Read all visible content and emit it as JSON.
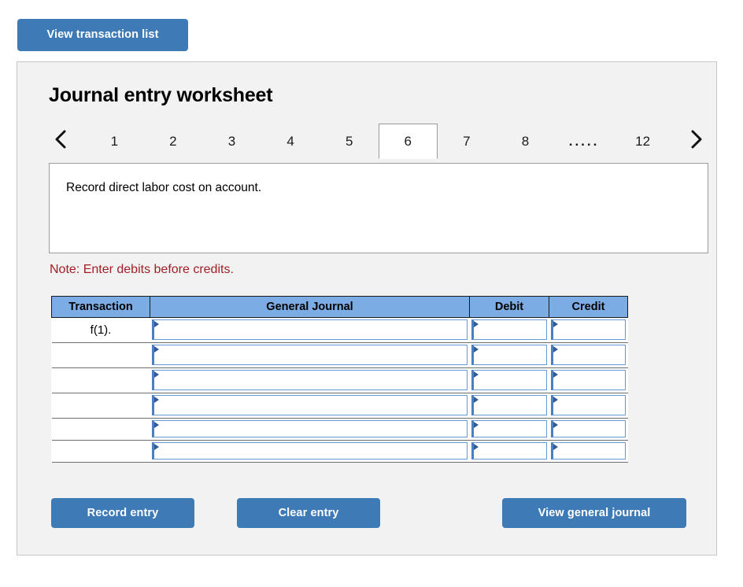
{
  "toolbar": {
    "view_transaction_list_label": "View transaction list"
  },
  "worksheet": {
    "title": "Journal entry worksheet",
    "description": "Record direct labor cost on account.",
    "note": "Note: Enter debits before credits."
  },
  "tabs": {
    "prev_icon": "chevron-left-icon",
    "next_icon": "chevron-right-icon",
    "items": [
      {
        "label": "1",
        "active": false
      },
      {
        "label": "2",
        "active": false
      },
      {
        "label": "3",
        "active": false
      },
      {
        "label": "4",
        "active": false
      },
      {
        "label": "5",
        "active": false
      },
      {
        "label": "6",
        "active": true
      },
      {
        "label": "7",
        "active": false
      },
      {
        "label": "8",
        "active": false
      },
      {
        "label": ".....",
        "active": false
      },
      {
        "label": "12",
        "active": false
      }
    ],
    "active_index": 5
  },
  "table": {
    "columns": [
      "Transaction",
      "General Journal",
      "Debit",
      "Credit"
    ],
    "rows": [
      {
        "transaction": "f(1).",
        "general_journal": "",
        "debit": "",
        "credit": ""
      },
      {
        "transaction": "",
        "general_journal": "",
        "debit": "",
        "credit": ""
      },
      {
        "transaction": "",
        "general_journal": "",
        "debit": "",
        "credit": ""
      },
      {
        "transaction": "",
        "general_journal": "",
        "debit": "",
        "credit": ""
      },
      {
        "transaction": "",
        "general_journal": "",
        "debit": "",
        "credit": ""
      },
      {
        "transaction": "",
        "general_journal": "",
        "debit": "",
        "credit": ""
      }
    ]
  },
  "actions": {
    "record_entry_label": "Record entry",
    "clear_entry_label": "Clear entry",
    "view_general_journal_label": "View general journal"
  },
  "colors": {
    "button_blue": "#3e7ab5",
    "table_header_blue": "#7cace4",
    "note_red": "#a01f26",
    "panel_bg": "#f2f2f2",
    "input_border_blue": "#6699d6"
  }
}
